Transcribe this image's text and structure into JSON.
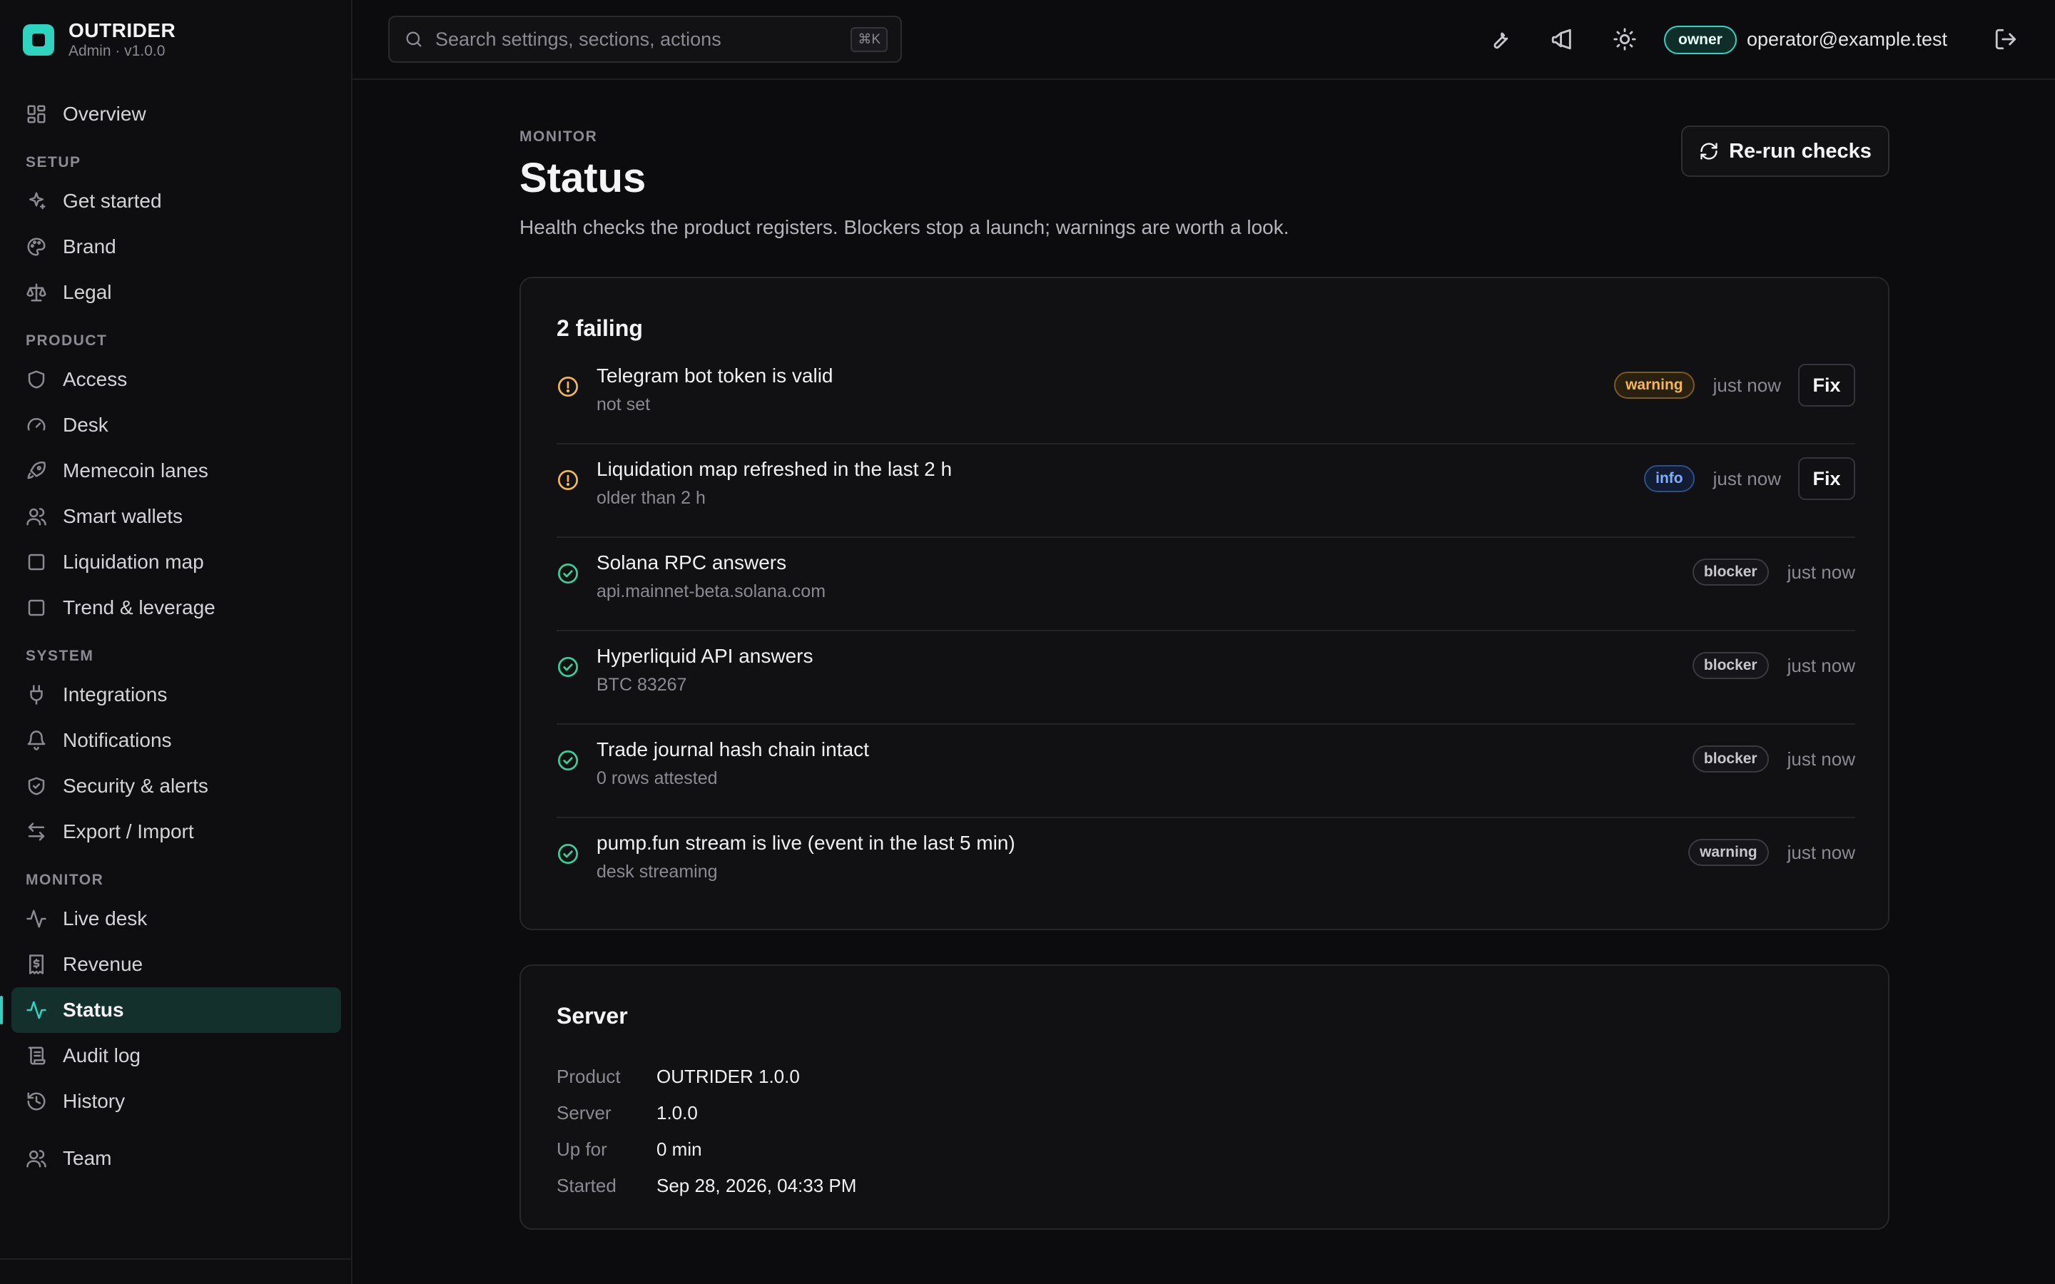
{
  "brand": {
    "name": "OUTRIDER",
    "subtitle": "Admin · v1.0.0"
  },
  "sidebar": {
    "overview": {
      "label": "Overview",
      "icon": "layout-grid-icon"
    },
    "sections": [
      {
        "label": "SETUP",
        "items": [
          {
            "label": "Get started",
            "icon": "sparkles-icon"
          },
          {
            "label": "Brand",
            "icon": "palette-icon"
          },
          {
            "label": "Legal",
            "icon": "scale-icon"
          }
        ]
      },
      {
        "label": "PRODUCT",
        "items": [
          {
            "label": "Access",
            "icon": "shield-icon"
          },
          {
            "label": "Desk",
            "icon": "gauge-icon"
          },
          {
            "label": "Memecoin lanes",
            "icon": "rocket-icon"
          },
          {
            "label": "Smart wallets",
            "icon": "users-icon"
          },
          {
            "label": "Liquidation map",
            "icon": "square-icon"
          },
          {
            "label": "Trend & leverage",
            "icon": "square-icon"
          }
        ]
      },
      {
        "label": "SYSTEM",
        "items": [
          {
            "label": "Integrations",
            "icon": "plug-icon"
          },
          {
            "label": "Notifications",
            "icon": "bell-icon"
          },
          {
            "label": "Security & alerts",
            "icon": "shield-check-icon"
          },
          {
            "label": "Export / Import",
            "icon": "arrows-left-right-icon"
          }
        ]
      },
      {
        "label": "MONITOR",
        "items": [
          {
            "label": "Live desk",
            "icon": "activity-icon"
          },
          {
            "label": "Revenue",
            "icon": "receipt-dollar-icon"
          },
          {
            "label": "Status",
            "icon": "activity-icon",
            "active": true
          },
          {
            "label": "Audit log",
            "icon": "scroll-icon"
          },
          {
            "label": "History",
            "icon": "history-icon"
          }
        ]
      }
    ],
    "team": {
      "label": "Team",
      "icon": "users-icon"
    }
  },
  "topbar": {
    "search_placeholder": "Search settings, sections, actions",
    "search_shortcut": "⌘K",
    "role": "owner",
    "email": "operator@example.test",
    "icons": [
      "wrench-icon",
      "megaphone-icon",
      "sun-icon",
      "log-out-icon"
    ]
  },
  "page": {
    "kicker": "MONITOR",
    "title": "Status",
    "description": "Health checks the product registers. Blockers stop a launch; warnings are worth a look.",
    "rerun_label": "Re-run checks"
  },
  "checks": {
    "title": "2 failing",
    "fix_label": "Fix",
    "items": [
      {
        "name": "Telegram bot token is valid",
        "detail": "not set",
        "status": "failing",
        "severity": "warning",
        "time": "just now",
        "fix": true
      },
      {
        "name": "Liquidation map refreshed in the last 2 h",
        "detail": "older than 2 h",
        "status": "failing",
        "severity": "info",
        "time": "just now",
        "fix": true
      },
      {
        "name": "Solana RPC answers",
        "detail": "api.mainnet-beta.solana.com",
        "status": "ok",
        "severity": "blocker",
        "time": "just now",
        "fix": false
      },
      {
        "name": "Hyperliquid API answers",
        "detail": "BTC 83267",
        "status": "ok",
        "severity": "blocker",
        "time": "just now",
        "fix": false
      },
      {
        "name": "Trade journal hash chain intact",
        "detail": "0 rows attested",
        "status": "ok",
        "severity": "blocker",
        "time": "just now",
        "fix": false
      },
      {
        "name": "pump.fun stream is live (event in the last 5 min)",
        "detail": "desk streaming",
        "status": "ok",
        "severity": "warning",
        "time": "just now",
        "fix": false
      }
    ]
  },
  "server": {
    "title": "Server",
    "rows": [
      {
        "key": "Product",
        "value": "OUTRIDER 1.0.0"
      },
      {
        "key": "Server",
        "value": "1.0.0"
      },
      {
        "key": "Up for",
        "value": "0 min"
      },
      {
        "key": "Started",
        "value": "Sep 28, 2026, 04:33 PM"
      }
    ]
  },
  "colors": {
    "accent": "#2dd4bf",
    "warning": "#f5b94a",
    "info": "#7fb0ff",
    "ok": "#34d399",
    "background": "#0c0c0e"
  }
}
